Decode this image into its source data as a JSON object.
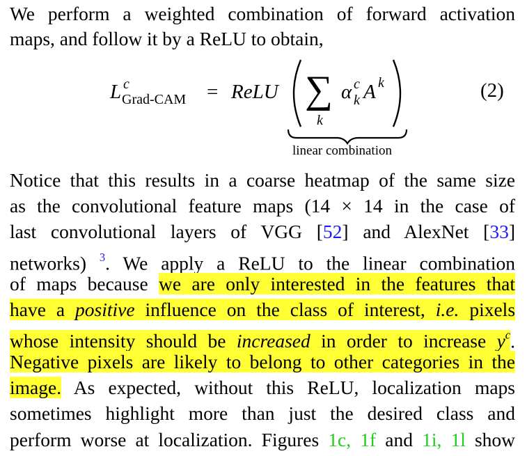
{
  "text": {
    "l1": "We perform a weighted combination of forward activation",
    "l2": "maps, and follow it by a ReLU to obtain,",
    "l3": "Notice that this results in a coarse heatmap of the same size",
    "l4a": "as the convolutional feature maps (14 × 14 in the case of",
    "l5a": "last convolutional layers of VGG [",
    "l5cite1": "52",
    "l5b": "] and AlexNet [",
    "l5cite2": "33",
    "l5c": "]",
    "l6a": "networks)",
    "l6fn": "3",
    "l6b": ". We apply a ReLU to the linear combination",
    "l7a": "of maps because",
    "l7b": "we are only interested in the features that",
    "l8a": "have a",
    "l8b": "positive",
    "l8c": "influence on the class of interest,",
    "l8d": "i.e.",
    "l8e": "pixels",
    "l9a": "whose intensity should be",
    "l9b": "increased",
    "l9c": "in order to increase",
    "l9d": "y",
    "l9e": "c",
    "l9f": ".",
    "l10": "Negative pixels are likely to belong to other categories in the",
    "l11a": "image.",
    "l11b": "As expected, without this ReLU, localization maps",
    "l12": "sometimes highlight more than just the desired class and",
    "l13a": "perform worse at localization. Figures",
    "l13f1": "1c, 1f",
    "l13b": "and",
    "l13f2": "1i, 1l",
    "l13c": "show"
  },
  "equation": {
    "lhs_symbol": "L",
    "lhs_sup": "c",
    "lhs_sub": "Grad-CAM",
    "equals": "=",
    "relu": "ReLU",
    "sum_symbol": "∑",
    "sum_index": "k",
    "alpha": "α",
    "alpha_sup": "c",
    "alpha_sub": "k",
    "A": "A",
    "A_sup": "k",
    "brace_label": "linear combination",
    "number": "(2)"
  },
  "colors": {
    "highlight": "#ffff33",
    "citation": "#1a1aff",
    "figure_ref": "#22cc22"
  }
}
